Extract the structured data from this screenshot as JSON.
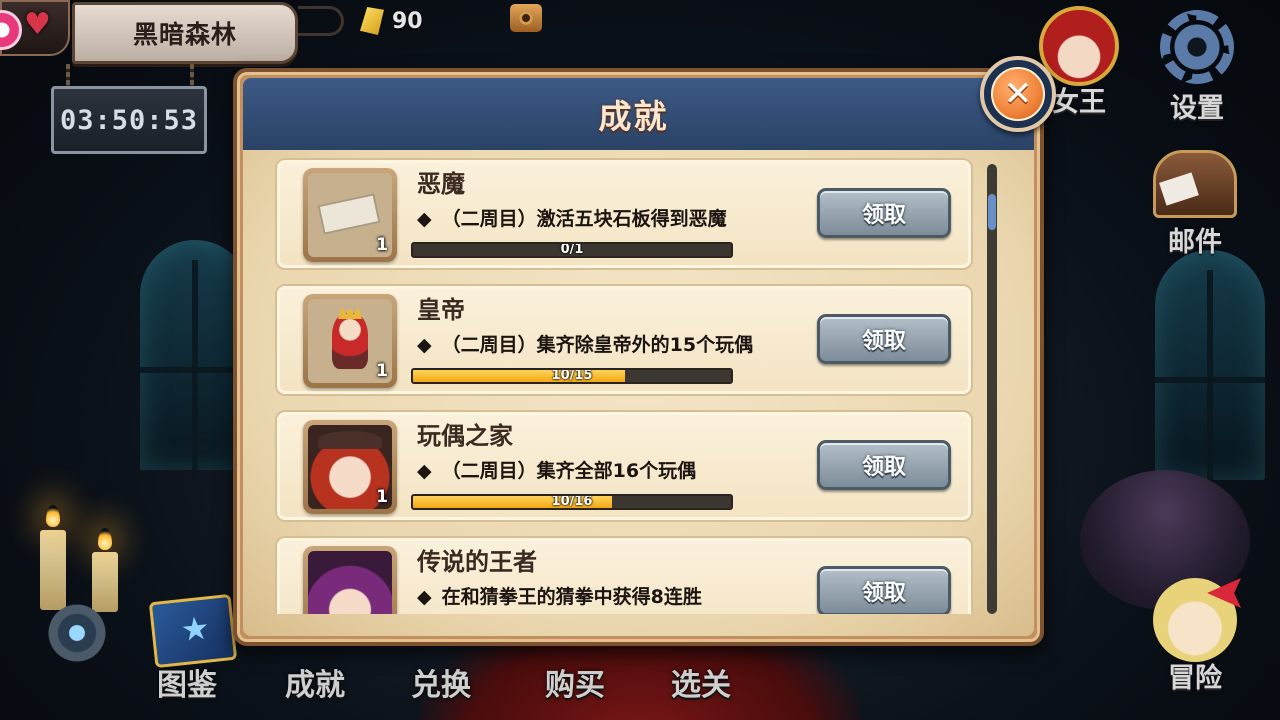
{
  "hud": {
    "location": "黑暗森林",
    "timer": "03:50:53",
    "gems": "90"
  },
  "side_menu": [
    {
      "label": "女王",
      "icon": "queen-crown-icon"
    },
    {
      "label": "设置",
      "icon": "gear-icon"
    },
    {
      "label": "邮件",
      "icon": "mailbox-icon"
    },
    {
      "label": "冒险",
      "icon": "adventure-doll-icon"
    }
  ],
  "bottom_nav": [
    {
      "label": "图鉴",
      "icon": "book-icon"
    },
    {
      "label": "成就",
      "icon": "achievement-icon"
    },
    {
      "label": "兑换",
      "icon": "exchange-icon"
    },
    {
      "label": "购买",
      "icon": "shop-icon"
    },
    {
      "label": "选关",
      "icon": "level-select-icon"
    }
  ],
  "dialog": {
    "title": "成就",
    "close_icon": "✕",
    "claim_label": "领取",
    "scroll_fraction": 0.0,
    "achievements": [
      {
        "name": "恶魔",
        "bullet": "◆",
        "description": "（二周目）激活五块石板得到恶魔",
        "progress_text": "0/1",
        "progress": 0.0,
        "reward_qty": "1",
        "reward_icon": "stone-tablet-ticket-icon"
      },
      {
        "name": "皇帝",
        "bullet": "◆",
        "description": "（二周目）集齐除皇帝外的15个玩偶",
        "progress_text": "10/15",
        "progress": 0.667,
        "reward_qty": "1",
        "reward_icon": "emperor-doll-icon"
      },
      {
        "name": "玩偶之家",
        "bullet": "◆",
        "description": "（二周目）集齐全部16个玩偶",
        "progress_text": "10/16",
        "progress": 0.625,
        "reward_qty": "1",
        "reward_icon": "doll-portrait-icon"
      },
      {
        "name": "传说的王者",
        "bullet": "◆",
        "description": "在和猜拳王的猜拳中获得8连胜",
        "progress_text": "",
        "progress": 0.0,
        "reward_qty": "",
        "reward_icon": "purple-hair-doll-icon"
      }
    ]
  },
  "colors": {
    "header_blue": "#2f4a72",
    "progress_fill": "#f3a814",
    "claim_button": "#8e9ca8",
    "close_orange": "#f0833a"
  }
}
